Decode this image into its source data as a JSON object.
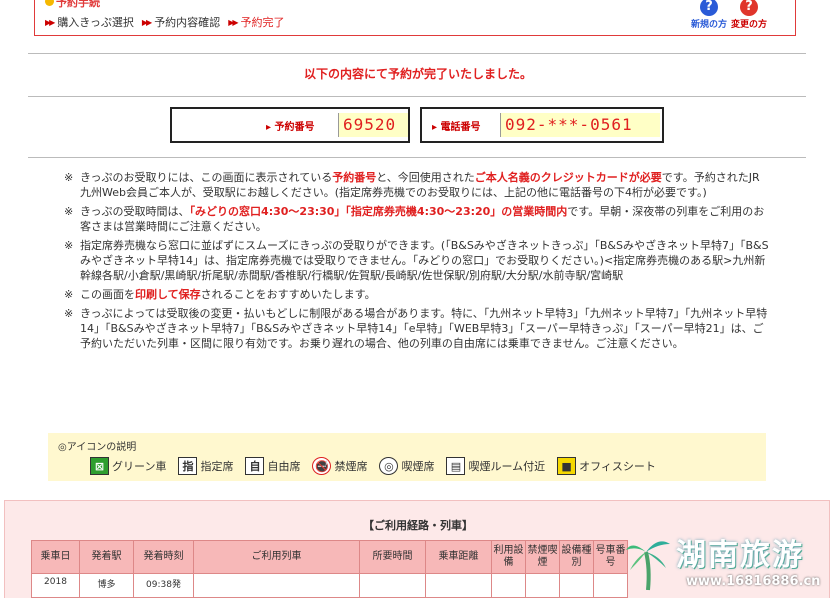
{
  "header": {
    "cut_title": "予約手続",
    "steps": [
      {
        "label": "購入きっぷ選択"
      },
      {
        "label": "予約内容確認"
      },
      {
        "label": "予約完了"
      }
    ],
    "help_new": "新規の方",
    "help_change": "変更の方",
    "help_symbol": "?"
  },
  "message": "以下の内容にて予約が完了いたしました。",
  "reservation": {
    "number_label": "予約番号",
    "number_value": "69520",
    "phone_label": "電話番号",
    "phone_value": "092-***-0561"
  },
  "notes": {
    "mark": "※",
    "n1_a": "きっぷのお受取りには、この画面に表示されている",
    "n1_b": "予約番号",
    "n1_c": "と、今回使用された",
    "n1_d": "ご本人名義のクレジットカードが必要",
    "n1_e": "です。予約されたJR九州Web会員ご本人が、受取駅にお越しください。(指定席券売機でのお受取りには、上記の他に電話番号の下4桁が必要です。)",
    "n2_a": "きっぷの受取時間は、",
    "n2_b": "「みどりの窓口4:30〜23:30」「指定席券売機4:30〜23:20」の営業時間内",
    "n2_c": "です。早朝・深夜帯の列車をご利用のお客さまは営業時間にご注意ください。",
    "n3": "指定席券売機なら窓口に並ばずにスムーズにきっぷの受取りができます。(「B&Sみやざきネットきっぷ」「B&Sみやざきネット早特7」「B&Sみやざきネット早特14」は、指定席券売機では受取りできません。「みどりの窓口」でお受取りください。)<指定席券売機のある駅>九州新幹線各駅/小倉駅/黒崎駅/折尾駅/赤間駅/香椎駅/行橋駅/佐賀駅/長崎駅/佐世保駅/別府駅/大分駅/水前寺駅/宮崎駅",
    "n4_a": "この画面を",
    "n4_b": "印刷して保存",
    "n4_c": "されることをおすすめいたします。",
    "n5": "きっぷによっては受取後の変更・払いもどしに制限がある場合があります。特に、「九州ネット早特3」「九州ネット早特7」「九州ネット早特14」「B&Sみやざきネット早特7」「B&Sみやざきネット早特14」「e早特」「WEB早特3」「スーパー早特きっぷ」「スーパー早特21」は、ご予約いただいた列車・区間に限り有効です。お乗り遅れの場合、他の列車の自由席には乗車できません。ご注意ください。"
  },
  "legend": {
    "title": "◎アイコンの説明",
    "items": [
      {
        "label": "グリーン車",
        "glyph": "⊠"
      },
      {
        "label": "指定席",
        "glyph": "指"
      },
      {
        "label": "自由席",
        "glyph": "自"
      },
      {
        "label": "禁煙席",
        "glyph": "🚭"
      },
      {
        "label": "喫煙席",
        "glyph": "◎"
      },
      {
        "label": "喫煙ルーム付近",
        "glyph": "▤"
      },
      {
        "label": "オフィスシート",
        "glyph": "■"
      }
    ]
  },
  "route": {
    "title": "【ご利用経路・列車】",
    "headers": [
      "乗車日",
      "発着駅",
      "発着時刻",
      "ご利用列車",
      "所要時間",
      "乗車距離",
      "利用設備",
      "禁煙喫煙",
      "設備種別",
      "号車番号"
    ],
    "row": {
      "date": "2018",
      "station": "博多",
      "time": "09:38発"
    }
  },
  "watermark": {
    "text": "湖南旅游",
    "url": "www.16816886.cn"
  }
}
